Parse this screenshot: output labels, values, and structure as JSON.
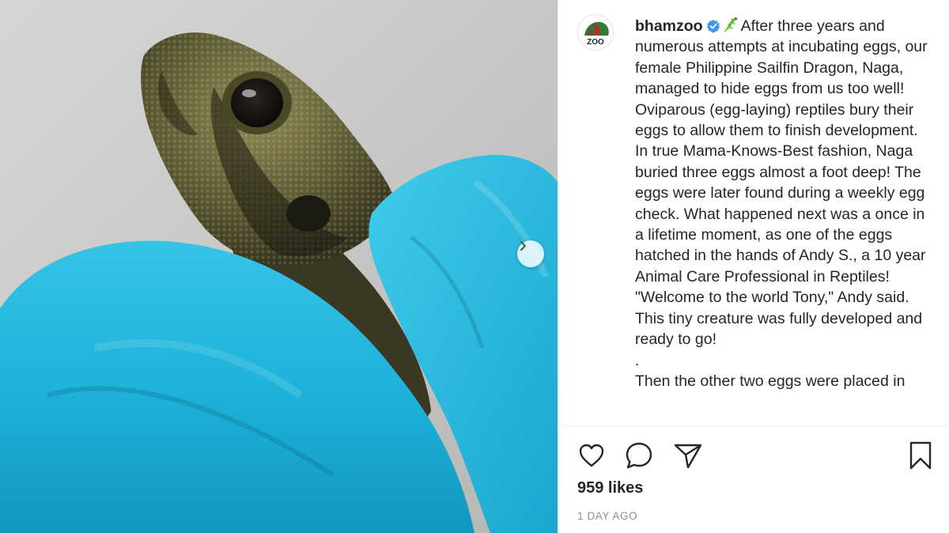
{
  "post": {
    "image_alt": "Baby Philippine Sailfin Dragon held in blue gloved hands",
    "next_icon": "chevron-right-icon"
  },
  "author": {
    "username": "bhamzoo",
    "avatar_text": "ZOO",
    "verified_icon": "verified-badge-icon"
  },
  "caption": {
    "emoji_icon": "lizard-emoji",
    "text": "After three years and numerous attempts at incubating eggs, our female Philippine Sailfin Dragon, Naga, managed to hide eggs from us too well! Oviparous (egg-laying) reptiles bury their eggs to allow them to finish development. In true Mama-Knows-Best fashion, Naga buried three eggs almost a foot deep! The eggs were later found during a weekly egg check. What happened next was a once in a lifetime moment, as one of the eggs hatched in the hands of Andy S., a 10 year Animal Care Professional in Reptiles! \"Welcome to the world Tony,\" Andy said. This tiny creature was fully developed and ready to go!\n.\nThen the other two eggs were placed in"
  },
  "actions": {
    "like_icon": "heart-icon",
    "comment_icon": "comment-icon",
    "share_icon": "send-icon",
    "save_icon": "bookmark-icon"
  },
  "stats": {
    "likes": "959 likes",
    "time_ago": "1 DAY AGO"
  },
  "colors": {
    "glove": "#1fb6d9",
    "text": "#262626",
    "muted": "#8e8e8e",
    "verified": "#3897f0",
    "lizard_emoji": "#5cbf2a"
  }
}
